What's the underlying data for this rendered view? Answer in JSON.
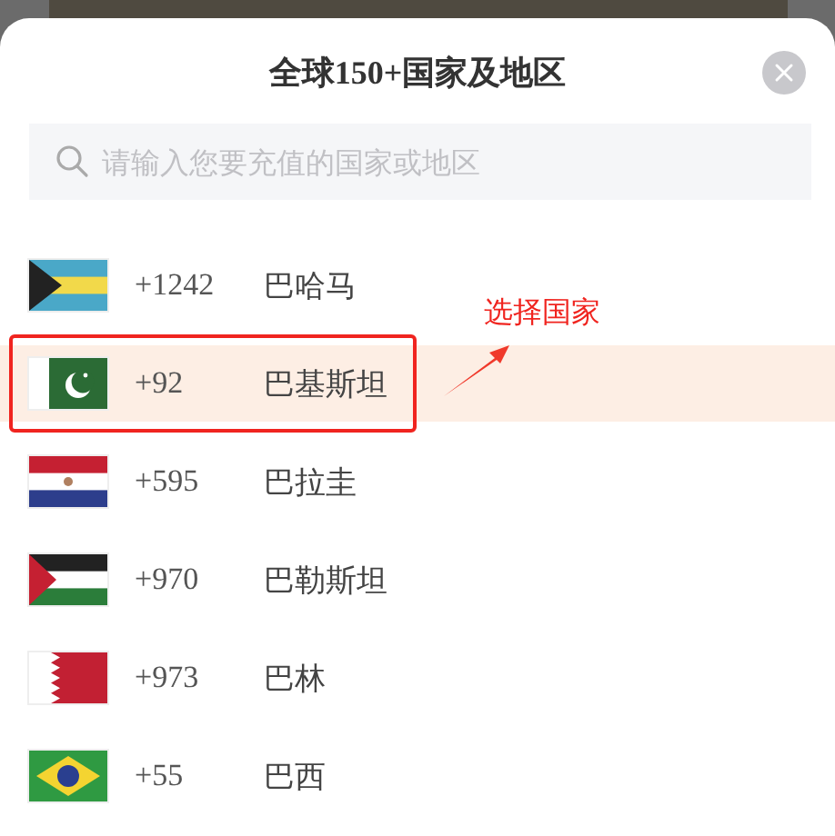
{
  "sheet": {
    "title": "全球150+国家及地区",
    "search": {
      "placeholder": "请输入您要充值的国家或地区"
    }
  },
  "countries": [
    {
      "kind": "bahamas",
      "code": "+1242",
      "name": "巴哈马",
      "selected": false
    },
    {
      "kind": "pakistan",
      "code": "+92",
      "name": "巴基斯坦",
      "selected": true
    },
    {
      "kind": "paraguay",
      "code": "+595",
      "name": "巴拉圭",
      "selected": false
    },
    {
      "kind": "palestine",
      "code": "+970",
      "name": "巴勒斯坦",
      "selected": false
    },
    {
      "kind": "bahrain",
      "code": "+973",
      "name": "巴林",
      "selected": false
    },
    {
      "kind": "brazil",
      "code": "+55",
      "name": "巴西",
      "selected": false
    }
  ],
  "annotation": {
    "text": "选择国家"
  }
}
